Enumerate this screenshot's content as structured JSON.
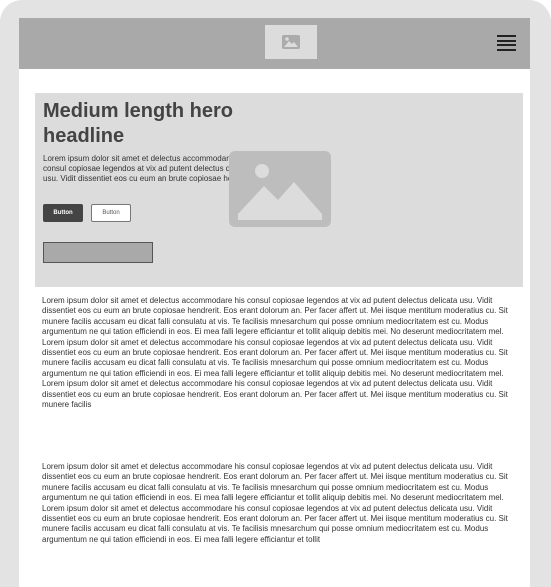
{
  "header": {
    "logo_icon": "image-icon",
    "menu_icon": "hamburger-menu-icon",
    "background": "#a9a9a9"
  },
  "hero": {
    "headline": "Medium length hero headline",
    "body": "Lorem ipsum dolor sit amet et delectus accommodare his consul copiosae legendos at vix ad putent delectus delicata usu. Vidit dissentiet eos cu eum an brute copiosae hendrerit.",
    "primary_button": "Button",
    "secondary_button": "Button",
    "image_icon": "image-placeholder-icon",
    "background": "#dcdcdc"
  },
  "content": {
    "paragraph_1": "Lorem ipsum dolor sit amet et delectus accommodare his consul copiosae legendos at vix ad putent delectus delicata usu. Vidit dissentiet eos cu eum an brute copiosae hendrerit. Eos erant dolorum an. Per facer affert ut. Mei iisque mentitum moderatius cu. Sit munere facilis accusam eu dicat falli consulatu at vis. Te facilisis mnesarchum qui posse omnium mediocritatem est cu. Modus argumentum ne qui tation efficiendi in eos. Ei mea falli legere efficiantur et tollit aliquip debitis mei. No deserunt mediocritatem mel. Lorem ipsum dolor sit amet et delectus accommodare his consul copiosae legendos at vix ad putent delectus delicata usu. Vidit dissentiet eos cu eum an brute copiosae hendrerit. Eos erant dolorum an. Per facer affert ut. Mei iisque mentitum moderatius cu. Sit munere facilis accusam eu dicat falli consulatu at vis. Te facilisis mnesarchum qui posse omnium mediocritatem est cu. Modus argumentum ne qui tation efficiendi in eos. Ei mea falli legere efficiantur et tollit aliquip debitis mei. No deserunt mediocritatem mel. Lorem ipsum dolor sit amet et delectus accommodare his consul copiosae legendos at vix ad putent delectus delicata usu. Vidit dissentiet eos cu eum an brute copiosae hendrerit. Eos erant dolorum an. Per facer affert ut. Mei iisque mentitum moderatius cu. Sit munere facilis",
    "paragraph_2": "Lorem ipsum dolor sit amet et delectus accommodare his consul copiosae legendos at vix ad putent delectus delicata usu. Vidit dissentiet eos cu eum an brute copiosae hendrerit. Eos erant dolorum an. Per facer affert ut. Mei iisque mentitum moderatius cu. Sit munere facilis accusam eu dicat falli consulatu at vis. Te facilisis mnesarchum qui posse omnium mediocritatem est cu. Modus argumentum ne qui tation efficiendi in eos. Ei mea falli legere efficiantur et tollit aliquip debitis mei. No deserunt mediocritatem mel. Lorem ipsum dolor sit amet et delectus accommodare his consul copiosae legendos at vix ad putent delectus delicata usu. Vidit dissentiet eos cu eum an brute copiosae hendrerit. Eos erant dolorum an. Per facer affert ut. Mei iisque mentitum moderatius cu. Sit munere facilis accusam eu dicat falli consulatu at vis. Te facilisis mnesarchum qui posse omnium mediocritatem est cu. Modus argumentum ne qui tation efficiendi in eos. Ei mea falli legere efficiantur et tollit"
  }
}
